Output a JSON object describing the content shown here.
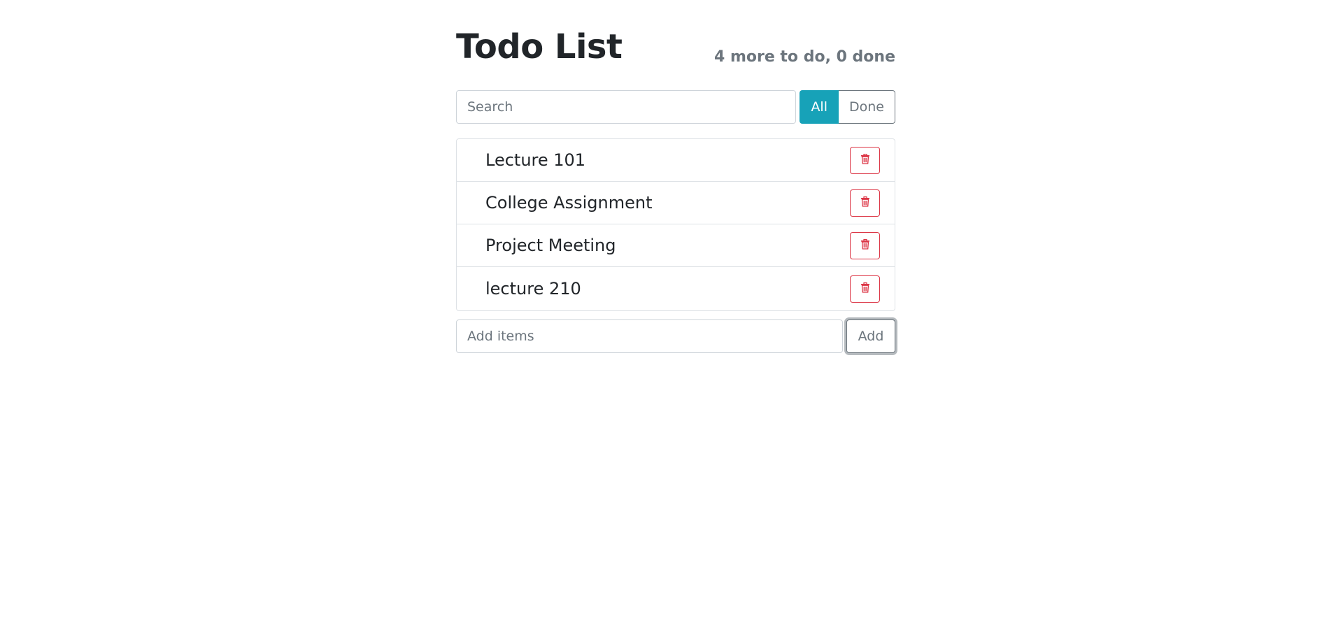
{
  "header": {
    "title": "Todo List",
    "stats": "4 more to do, 0 done"
  },
  "search": {
    "placeholder": "Search",
    "value": ""
  },
  "filters": {
    "all_label": "All",
    "done_label": "Done",
    "active": "All",
    "active_color": "#17a2b8"
  },
  "items": [
    {
      "label": "Lecture 101",
      "icon": "trash-icon"
    },
    {
      "label": "College Assignment",
      "icon": "trash-icon"
    },
    {
      "label": "Project Meeting",
      "icon": "trash-icon"
    },
    {
      "label": "lecture 210",
      "icon": "trash-icon"
    }
  ],
  "add": {
    "placeholder": "Add items",
    "value": "",
    "button_label": "Add"
  },
  "colors": {
    "delete": "#dc3545",
    "muted": "#6c757d"
  }
}
